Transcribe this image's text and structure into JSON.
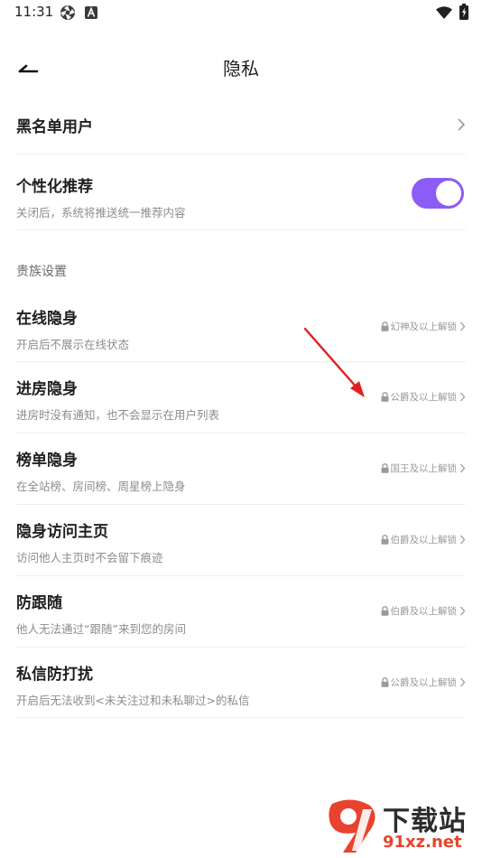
{
  "status_bar": {
    "time": "11:31",
    "icons": [
      "aperture-icon",
      "a-icon",
      "wifi-icon",
      "battery-charging-icon"
    ]
  },
  "header": {
    "back_icon": "arrow-left-icon",
    "title": "隐私"
  },
  "settings": {
    "blacklist": {
      "title": "黑名单用户",
      "icon": "chevron-right-icon"
    },
    "personalized": {
      "title": "个性化推荐",
      "description": "关闭后，系统将推送统一推荐内容",
      "enabled": true,
      "toggle_color": "#8b5cf6"
    }
  },
  "section": {
    "label": "贵族设置"
  },
  "noble_items": [
    {
      "title": "在线隐身",
      "description": "开启后不展示在线状态",
      "lock_text": "幻神及以上解锁"
    },
    {
      "title": "进房隐身",
      "description": "进房时没有通知，也不会显示在用户列表",
      "lock_text": "公爵及以上解锁"
    },
    {
      "title": "榜单隐身",
      "description": "在全站榜、房间榜、周星榜上隐身",
      "lock_text": "国王及以上解锁"
    },
    {
      "title": "隐身访问主页",
      "description": "访问他人主页时不会留下痕迹",
      "lock_text": "伯爵及以上解锁"
    },
    {
      "title": "防跟随",
      "description": "他人无法通过“跟随”来到您的房间",
      "lock_text": "伯爵及以上解锁"
    },
    {
      "title": "私信防打扰",
      "description": "开启后无法收到<未关注过和未私聊过>的私信",
      "lock_text": "公爵及以上解锁"
    }
  ],
  "annotation": {
    "type": "arrow",
    "color": "#e02020"
  },
  "watermark": {
    "logo_text": "91",
    "title": "下载站",
    "url": "91xz.net",
    "brand_color": "#e8432e"
  }
}
